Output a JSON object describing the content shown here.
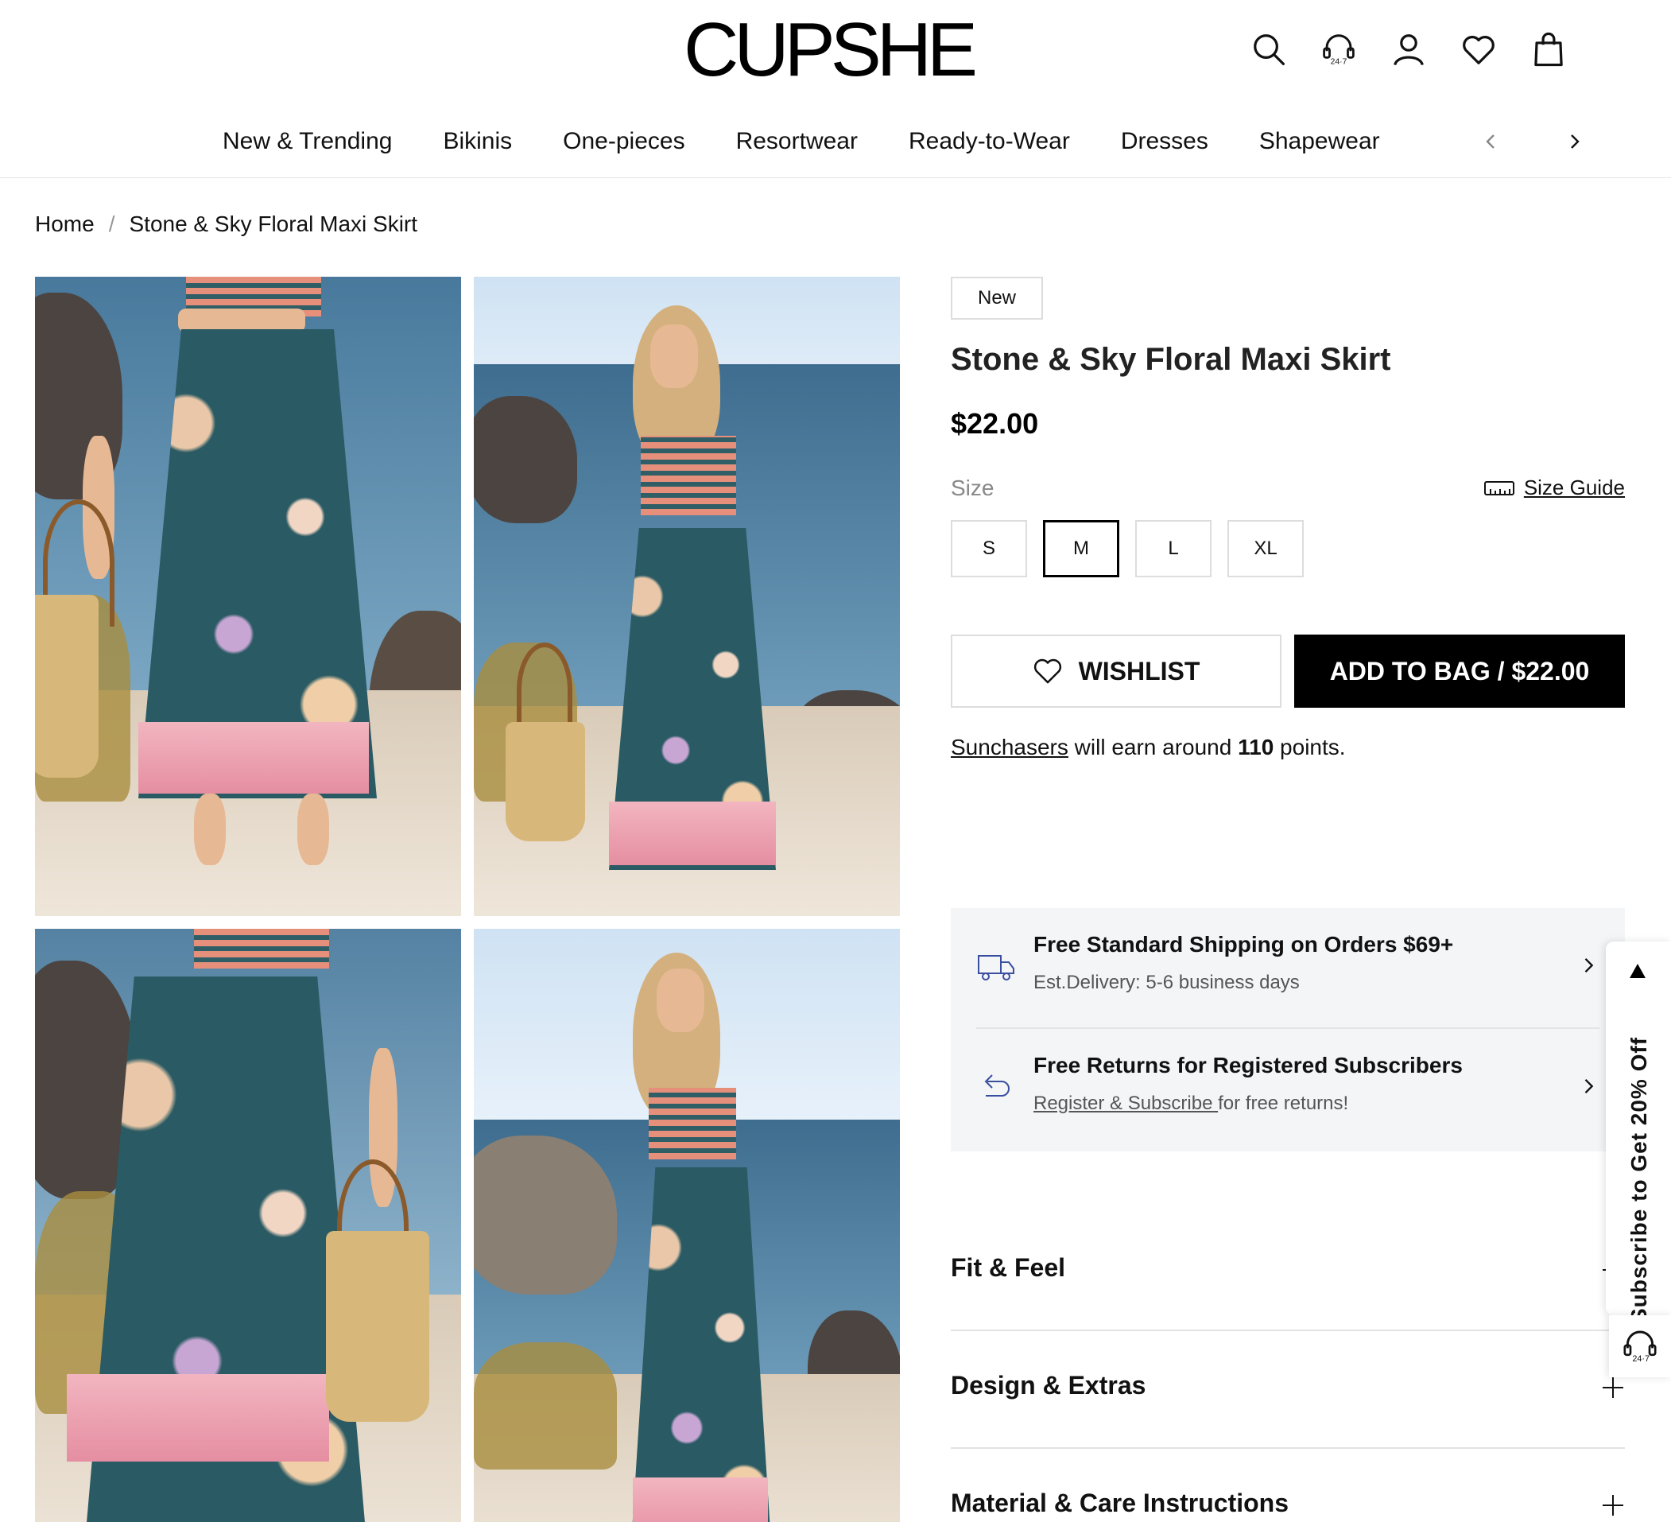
{
  "brand": {
    "logo": "CUPSHE"
  },
  "header": {
    "icons": [
      "search-icon",
      "support-24-7-icon",
      "account-icon",
      "wishlist-heart-icon",
      "shopping-bag-icon"
    ],
    "support_badge": "24·7"
  },
  "nav": {
    "items": [
      "New & Trending",
      "Bikinis",
      "One-pieces",
      "Resortwear",
      "Ready-to-Wear",
      "Dresses",
      "Shapewear"
    ]
  },
  "breadcrumb": {
    "home": "Home",
    "separator": "/",
    "current": "Stone & Sky Floral Maxi Skirt"
  },
  "product": {
    "badge": "New",
    "title": "Stone & Sky Floral Maxi Skirt",
    "price": "$22.00",
    "size_label": "Size",
    "size_guide": "Size Guide",
    "sizes": [
      "S",
      "M",
      "L",
      "XL"
    ],
    "selected_size": "M",
    "wishlist_label": "WISHLIST",
    "add_to_bag_label": "ADD TO BAG / $22.00",
    "points": {
      "link": "Sunchasers",
      "text_before": " will earn around ",
      "amount": "110",
      "text_after": " points."
    }
  },
  "shipping": {
    "shipping_title": "Free Standard Shipping on Orders $69+",
    "shipping_sub": "Est.Delivery: 5-6 business days",
    "returns_title": "Free Returns for Registered Subscribers",
    "returns_link": "Register & Subscribe ",
    "returns_sub": "for free returns!"
  },
  "accordion": [
    "Fit & Feel",
    "Design & Extras",
    "Material & Care Instructions"
  ],
  "side_tab": {
    "text": "Subscribe to Get 20% Off",
    "support_badge": "24·7"
  },
  "colors": {
    "accent": "#000000",
    "panel_bg": "#f4f5f7",
    "border": "#dddddd"
  }
}
